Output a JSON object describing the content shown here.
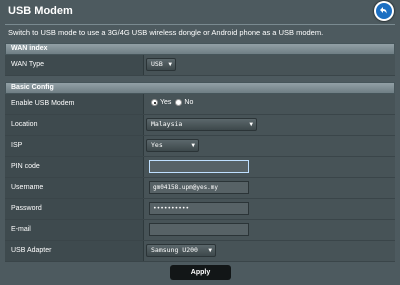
{
  "page": {
    "title": "USB Modem",
    "description": "Switch to USB mode to use a 3G/4G USB wireless dongle or Android phone as a USB modem."
  },
  "wan_index": {
    "header": "WAN index",
    "wan_type": {
      "label": "WAN Type",
      "value": "USB"
    }
  },
  "basic_config": {
    "header": "Basic Config",
    "enable_usb_modem": {
      "label": "Enable USB Modem",
      "options": [
        "Yes",
        "No"
      ],
      "selected": "Yes"
    },
    "location": {
      "label": "Location",
      "value": "Malaysia"
    },
    "isp": {
      "label": "ISP",
      "value": "Yes"
    },
    "pin_code": {
      "label": "PIN code",
      "value": ""
    },
    "username": {
      "label": "Username",
      "value": "gm04158.upm@yes.my"
    },
    "password": {
      "label": "Password",
      "value": "••••••••••"
    },
    "email": {
      "label": "E-mail",
      "value": ""
    },
    "usb_adapter": {
      "label": "USB Adapter",
      "value": "Samsung U200"
    }
  },
  "actions": {
    "apply_label": "Apply"
  },
  "colors": {
    "background": "#4d5a5f",
    "row": "#475357",
    "label_cell": "#3e4a4e",
    "accent_blue": "#1c6fc2",
    "button": "#121617"
  },
  "icons": {
    "back": "back-arrow-icon"
  }
}
